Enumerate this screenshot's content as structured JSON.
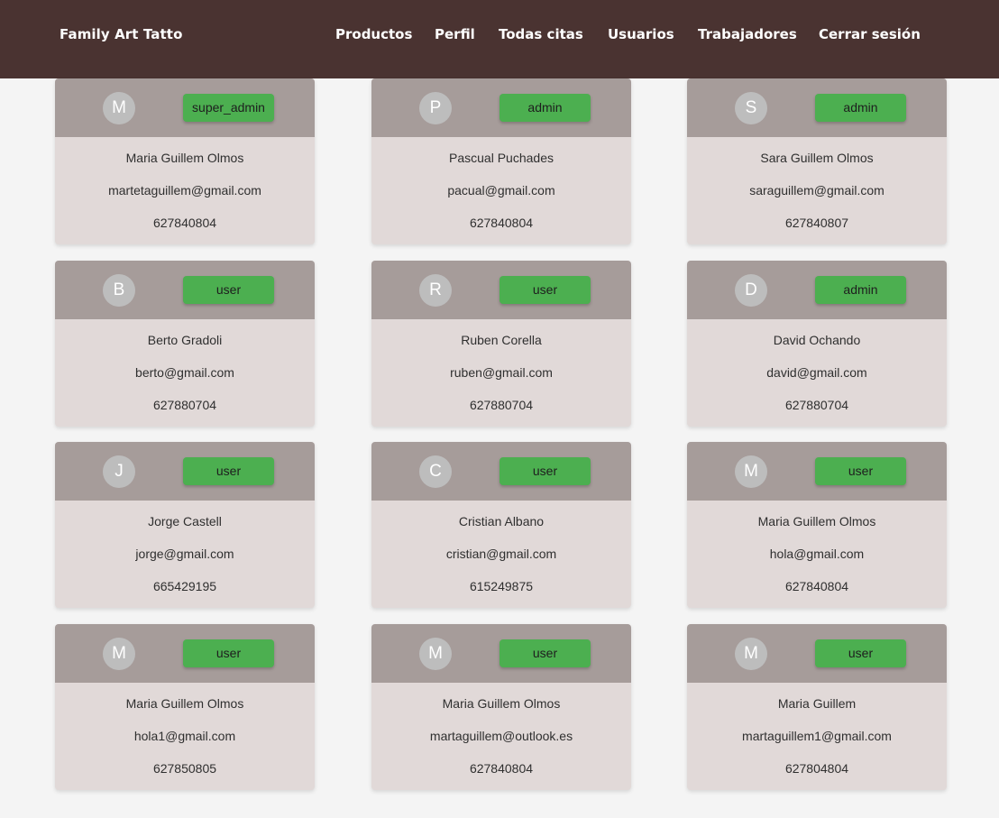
{
  "navbar": {
    "brand": "Family Art Tatto",
    "links": [
      "Productos",
      "Perfil",
      "Todas citas",
      "Usuarios",
      "Trabajadores",
      "Cerrar sesión"
    ]
  },
  "users": [
    {
      "initial": "M",
      "role": "super_admin",
      "name": "Maria Guillem Olmos",
      "email": "martetaguillem@gmail.com",
      "phone": "627840804"
    },
    {
      "initial": "P",
      "role": "admin",
      "name": "Pascual Puchades",
      "email": "pacual@gmail.com",
      "phone": "627840804"
    },
    {
      "initial": "S",
      "role": "admin",
      "name": "Sara Guillem Olmos",
      "email": "saraguillem@gmail.com",
      "phone": "627840807"
    },
    {
      "initial": "B",
      "role": "user",
      "name": "Berto Gradoli",
      "email": "berto@gmail.com",
      "phone": "627880704"
    },
    {
      "initial": "R",
      "role": "user",
      "name": "Ruben Corella",
      "email": "ruben@gmail.com",
      "phone": "627880704"
    },
    {
      "initial": "D",
      "role": "admin",
      "name": "David Ochando",
      "email": "david@gmail.com",
      "phone": "627880704"
    },
    {
      "initial": "J",
      "role": "user",
      "name": "Jorge Castell",
      "email": "jorge@gmail.com",
      "phone": "665429195"
    },
    {
      "initial": "C",
      "role": "user",
      "name": "Cristian Albano",
      "email": "cristian@gmail.com",
      "phone": "615249875"
    },
    {
      "initial": "M",
      "role": "user",
      "name": "Maria Guillem Olmos",
      "email": "hola@gmail.com",
      "phone": "627840804"
    },
    {
      "initial": "M",
      "role": "user",
      "name": "Maria Guillem Olmos",
      "email": "hola1@gmail.com",
      "phone": "627850805"
    },
    {
      "initial": "M",
      "role": "user",
      "name": "Maria Guillem Olmos",
      "email": "martaguillem@outlook.es",
      "phone": "627840804"
    },
    {
      "initial": "M",
      "role": "user",
      "name": "Maria Guillem",
      "email": "martaguillem1@gmail.com",
      "phone": "627804804"
    }
  ]
}
